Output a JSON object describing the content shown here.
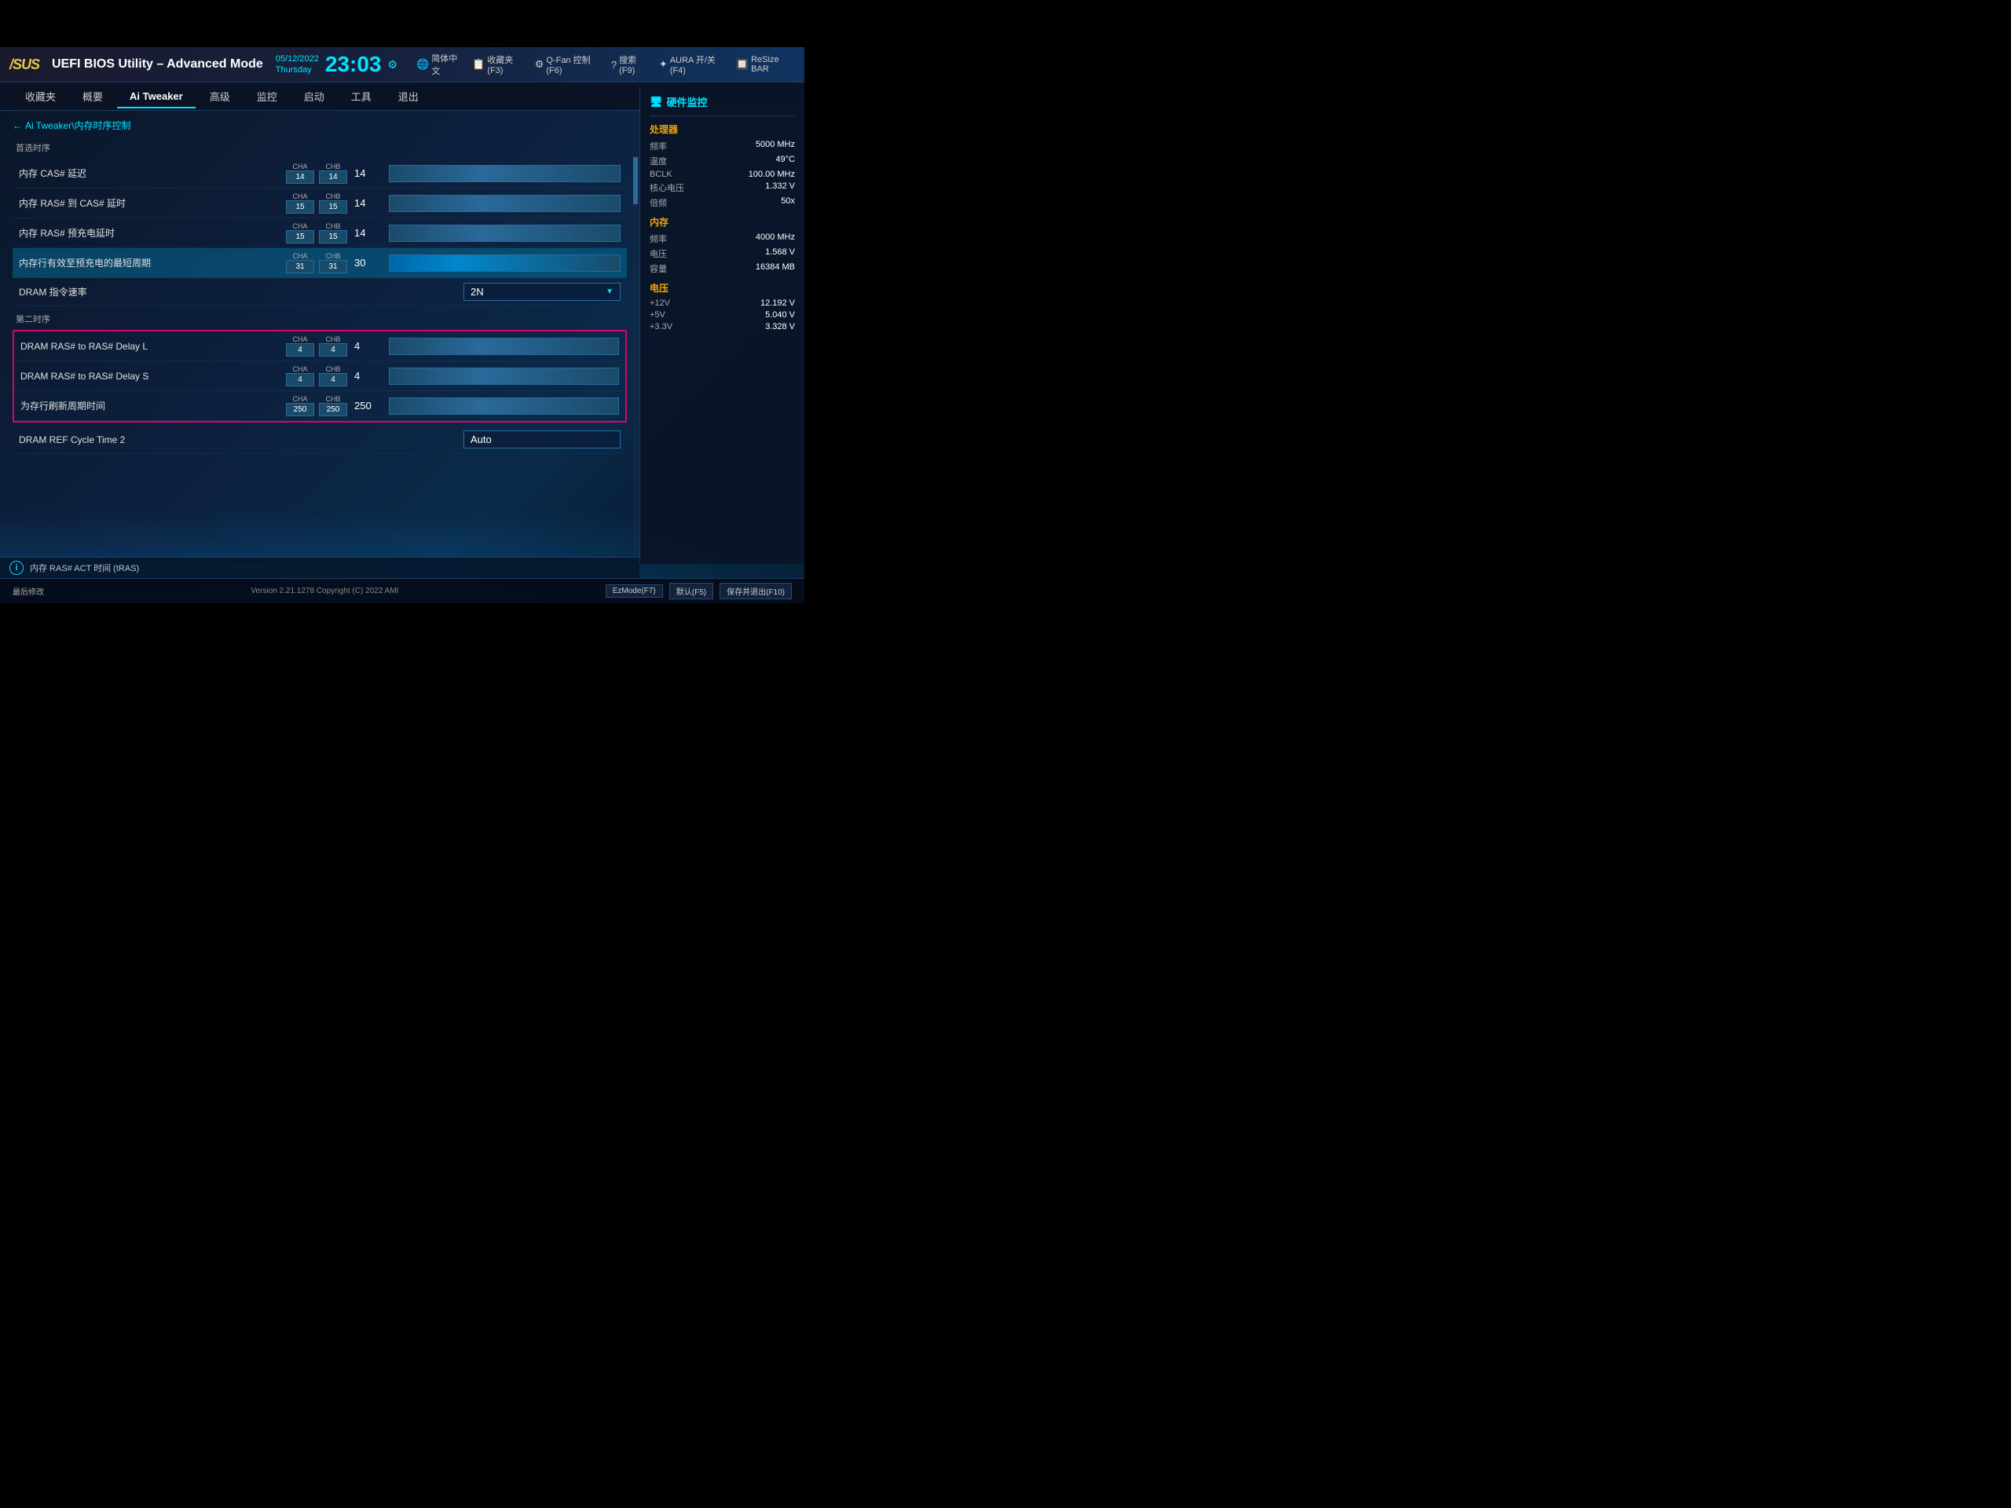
{
  "top": {
    "black_area_height": 60
  },
  "header": {
    "logo": "/SUS",
    "title": "UEFI BIOS Utility – Advanced Mode",
    "date": "05/12/2022",
    "day": "Thursday",
    "time": "23:03",
    "tools": [
      {
        "icon": "🌐",
        "label": "简体中文"
      },
      {
        "icon": "📋",
        "label": "收藏夹(F3)"
      },
      {
        "icon": "⚙",
        "label": "Q-Fan 控制(F6)"
      },
      {
        "icon": "?",
        "label": "搜索(F9)"
      },
      {
        "icon": "✦",
        "label": "AURA 开/关(F4)"
      },
      {
        "icon": "🔲",
        "label": "ReSize BAR"
      }
    ]
  },
  "nav": {
    "items": [
      {
        "label": "收藏夹",
        "active": false
      },
      {
        "label": "概要",
        "active": false
      },
      {
        "label": "Ai Tweaker",
        "active": true
      },
      {
        "label": "高级",
        "active": false
      },
      {
        "label": "监控",
        "active": false
      },
      {
        "label": "启动",
        "active": false
      },
      {
        "label": "工具",
        "active": false
      },
      {
        "label": "退出",
        "active": false
      }
    ]
  },
  "breadcrumb": {
    "arrow": "←",
    "path": "Ai Tweaker\\内存时序控制"
  },
  "sections": {
    "primary": {
      "label": "首选时序",
      "rows": [
        {
          "label": "内存 CAS# 延迟",
          "cha": "14",
          "chb": "14",
          "value": "14"
        },
        {
          "label": "内存 RAS# 到 CAS# 延时",
          "cha": "15",
          "chb": "15",
          "value": "14"
        },
        {
          "label": "内存 RAS# 预充电延时",
          "cha": "15",
          "chb": "15",
          "value": "14"
        },
        {
          "label": "内存行有效至预充电的最短周期",
          "cha": "31",
          "chb": "31",
          "value": "30",
          "active": true
        }
      ]
    },
    "dram_rate": {
      "label": "DRAM 指令速率",
      "value": "2N"
    },
    "secondary": {
      "label": "第二时序",
      "rows": [
        {
          "label": "DRAM RAS# to RAS# Delay L",
          "cha": "4",
          "chb": "4",
          "value": "4",
          "highlighted": true
        },
        {
          "label": "DRAM RAS# to RAS# Delay S",
          "cha": "4",
          "chb": "4",
          "value": "4",
          "highlighted": true
        },
        {
          "label": "为存行刷新周期时间",
          "cha": "250",
          "chb": "250",
          "value": "250",
          "highlighted": true
        }
      ]
    },
    "dram_ref": {
      "label": "DRAM REF Cycle Time 2",
      "value": "Auto"
    }
  },
  "info_bar": {
    "icon": "i",
    "text": "内存 RAS# ACT 时间 (tRAS)"
  },
  "hw_monitor": {
    "title": "硬件监控",
    "sections": [
      {
        "label": "处理器",
        "rows": [
          {
            "label": "频率",
            "value": "5000 MHz"
          },
          {
            "label": "温度",
            "value": "49°C"
          },
          {
            "label": "BCLK",
            "value": "100.00 MHz"
          },
          {
            "label": "核心电压",
            "value": "1.332 V"
          },
          {
            "label": "倍频",
            "value": "50x"
          }
        ]
      },
      {
        "label": "内存",
        "rows": [
          {
            "label": "频率",
            "value": "4000 MHz"
          },
          {
            "label": "电压",
            "value": "1.568 V"
          },
          {
            "label": "容量",
            "value": "16384 MB"
          }
        ]
      },
      {
        "label": "电压",
        "rows": [
          {
            "label": "+12V",
            "value": "12.192 V"
          },
          {
            "label": "+5V",
            "value": "5.040 V"
          },
          {
            "label": "+3.3V",
            "value": "3.328 V"
          }
        ]
      }
    ]
  },
  "footer": {
    "last_modified": "最后修改",
    "version": "Version 2.21.1278 Copyright (C) 2022 AMI",
    "buttons": [
      "EzMode(F7)",
      "默认(F5)",
      "保存并退出(F10)"
    ]
  },
  "cha_label": "CHA",
  "chb_label": "CHB"
}
